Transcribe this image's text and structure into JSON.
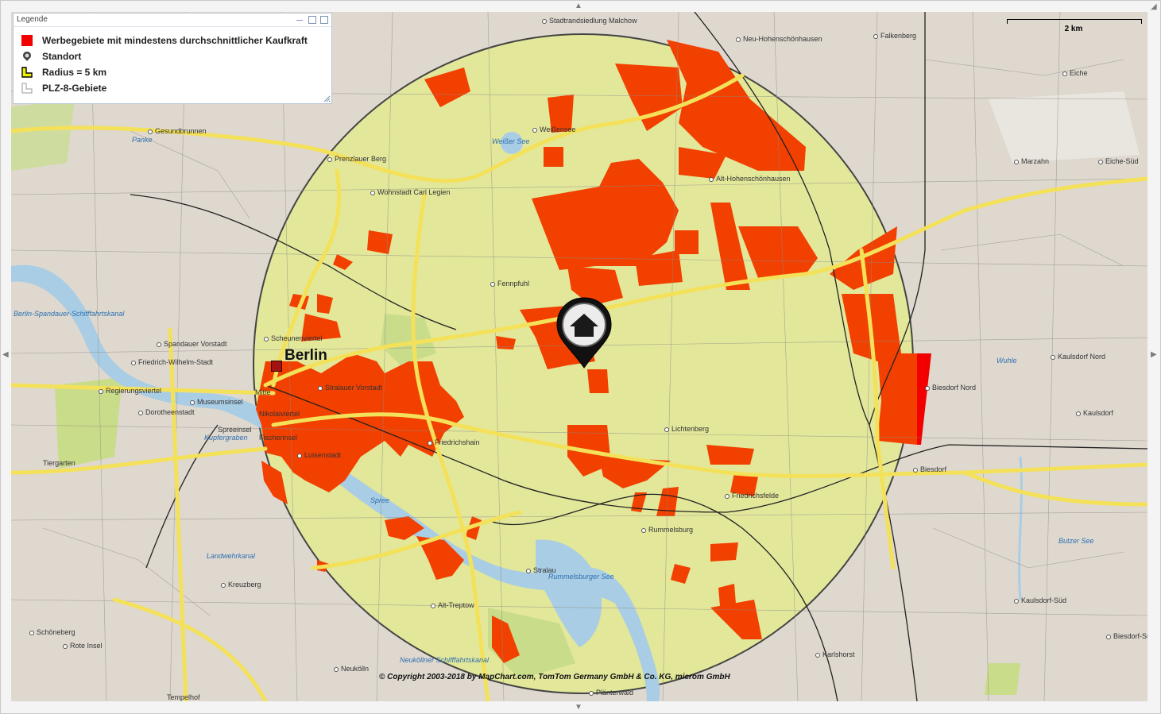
{
  "legend": {
    "title": "Legende",
    "items": [
      {
        "label": "Werbegebiete mit mindestens durchschnittlicher Kaufkraft",
        "icon": "red-square-icon"
      },
      {
        "label": "Standort",
        "icon": "location-pin-icon"
      },
      {
        "label": "Radius = 5 km",
        "icon": "radius-polygon-icon"
      },
      {
        "label": "PLZ-8-Gebiete",
        "icon": "plz-polygon-icon"
      }
    ]
  },
  "scale": {
    "label": "2 km"
  },
  "city": {
    "name": "Berlin"
  },
  "copyright": "© Copyright 2003-2018 by MapChart.com, TomTom Germany GmbH & Co. KG, microm GmbH",
  "places": [
    "Stadtrandsiedlung Malchow",
    "Neu-Hohenschönhausen",
    "Falkenberg",
    "Eiche",
    "Gesundbrunnen",
    "Weißensee",
    "Prenzlauer Berg",
    "Wohnstadt Carl Legien",
    "Alt-Hohenschönhausen",
    "Marzahn",
    "Eiche-Süd",
    "Fennpfuhl",
    "Scheunenviertel",
    "Spandauer Vorstadt",
    "Friedrich-Wilhelm-Stadt",
    "Regierungsviertel",
    "Mitte",
    "Stralauer Vorstadt",
    "Museumsinsel",
    "Dorotheenstadt",
    "Nikolaiviertel",
    "Spreeinsel",
    "Fischerinsel",
    "Luisenstadt",
    "Friedrichshain",
    "Lichtenberg",
    "Kaulsdorf Nord",
    "Biesdorf Nord",
    "Kaulsdorf",
    "Tiergarten",
    "Biesdorf",
    "Friedrichsfelde",
    "Rummelsburg",
    "Stralau",
    "Kreuzberg",
    "Alt-Treptow",
    "Kaulsdorf-Süd",
    "Biesdorf-Süd",
    "Schöneberg",
    "Rote Insel",
    "Karlshorst",
    "Neukölln",
    "Tempelhof",
    "Plänterwald"
  ],
  "waters": [
    "Panke",
    "Weißer See",
    "Berlin-Spandauer-Schifffahrtskanal",
    "Kupfergraben",
    "Spree",
    "Landwehrkanal",
    "Rummelsburger See",
    "Wuhle",
    "Butzer See",
    "Neuköllner Schifffahrtskanal"
  ],
  "colors": {
    "radius_fill": "#e2e79a",
    "advertising_area": "#f24000",
    "road_major": "#f4e15a",
    "map_background": "#ded8cf",
    "water": "#a9cde4",
    "park": "#c9dc8a"
  }
}
